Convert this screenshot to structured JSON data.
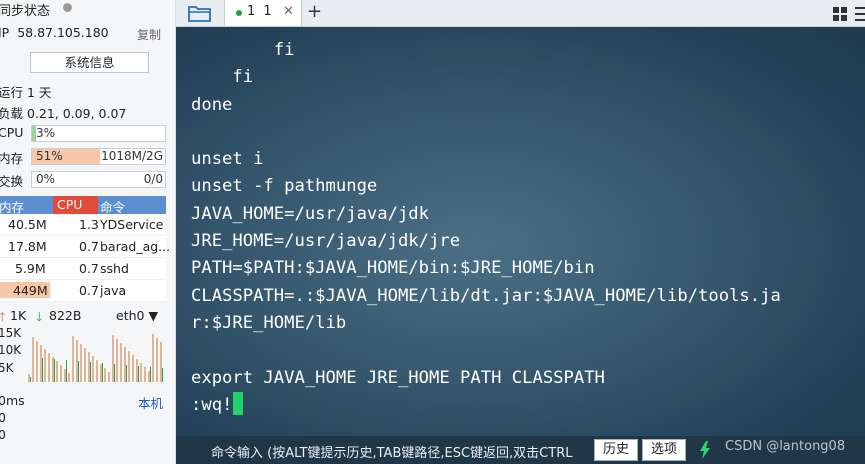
{
  "colors": {
    "terminal_bg": "#2b4a60",
    "cursor": "#22d36a",
    "header_blue": "#5b8fd0",
    "mem_fill": "#f8c7a8",
    "cpu_fill": "#9bd39b",
    "net_up": "#d9a07a",
    "net_down": "#2f9e3e"
  },
  "left_panel": {
    "sync_status": "同步状态",
    "ip_label": "IP",
    "ip": "58.87.105.180",
    "copy_label": "复制",
    "sysinfo_button": "系统信息",
    "uptime": "运行 1 天",
    "load": "负载 0.21, 0.09, 0.07",
    "metrics": [
      {
        "label": "CPU",
        "percent_text": "3%",
        "percent": 3,
        "right_text": ""
      },
      {
        "label": "内存",
        "percent_text": "51%",
        "percent": 51,
        "right_text": "1018M/2G"
      },
      {
        "label": "交换",
        "percent_text": "0%",
        "percent": 0,
        "right_text": "0/0"
      }
    ],
    "process_table": {
      "headers": [
        "内存",
        "CPU",
        "命令"
      ],
      "rows": [
        {
          "mem": "40.5M",
          "cpu": "1.3",
          "cmd": "YDService"
        },
        {
          "mem": "17.8M",
          "cpu": "0.7",
          "cmd": "barad_ag..."
        },
        {
          "mem": "5.9M",
          "cpu": "0.7",
          "cmd": "sshd"
        },
        {
          "mem": "449M",
          "cpu": "0.7",
          "cmd": "java"
        }
      ]
    },
    "network": {
      "up": "1K",
      "down": "822B",
      "interface": "eth0",
      "y_ticks": [
        "15K",
        "10K",
        "5K"
      ]
    },
    "latency": {
      "label": "0ms",
      "host": "本机",
      "y_ticks": [
        "0",
        "0"
      ]
    }
  },
  "terminal": {
    "tab_label": "1 1",
    "lines": [
      "        fi",
      "    fi",
      "done",
      "",
      "unset i",
      "unset -f pathmunge",
      "JAVA_HOME=/usr/java/jdk",
      "JRE_HOME=/usr/java/jdk/jre",
      "PATH=$PATH:$JAVA_HOME/bin:$JRE_HOME/bin",
      "CLASSPATH=.:$JAVA_HOME/lib/dt.jar:$JAVA_HOME/lib/tools.ja",
      "r:$JRE_HOME/lib",
      "",
      "export JAVA_HOME JRE_HOME PATH CLASSPATH",
      ":wq!"
    ]
  },
  "command_bar": {
    "hint": "命令输入 (按ALT键提示历史,TAB键路径,ESC键返回,双击CTRL",
    "history_button": "历史",
    "options_button": "选项"
  },
  "watermark": "CSDN @lantong08"
}
